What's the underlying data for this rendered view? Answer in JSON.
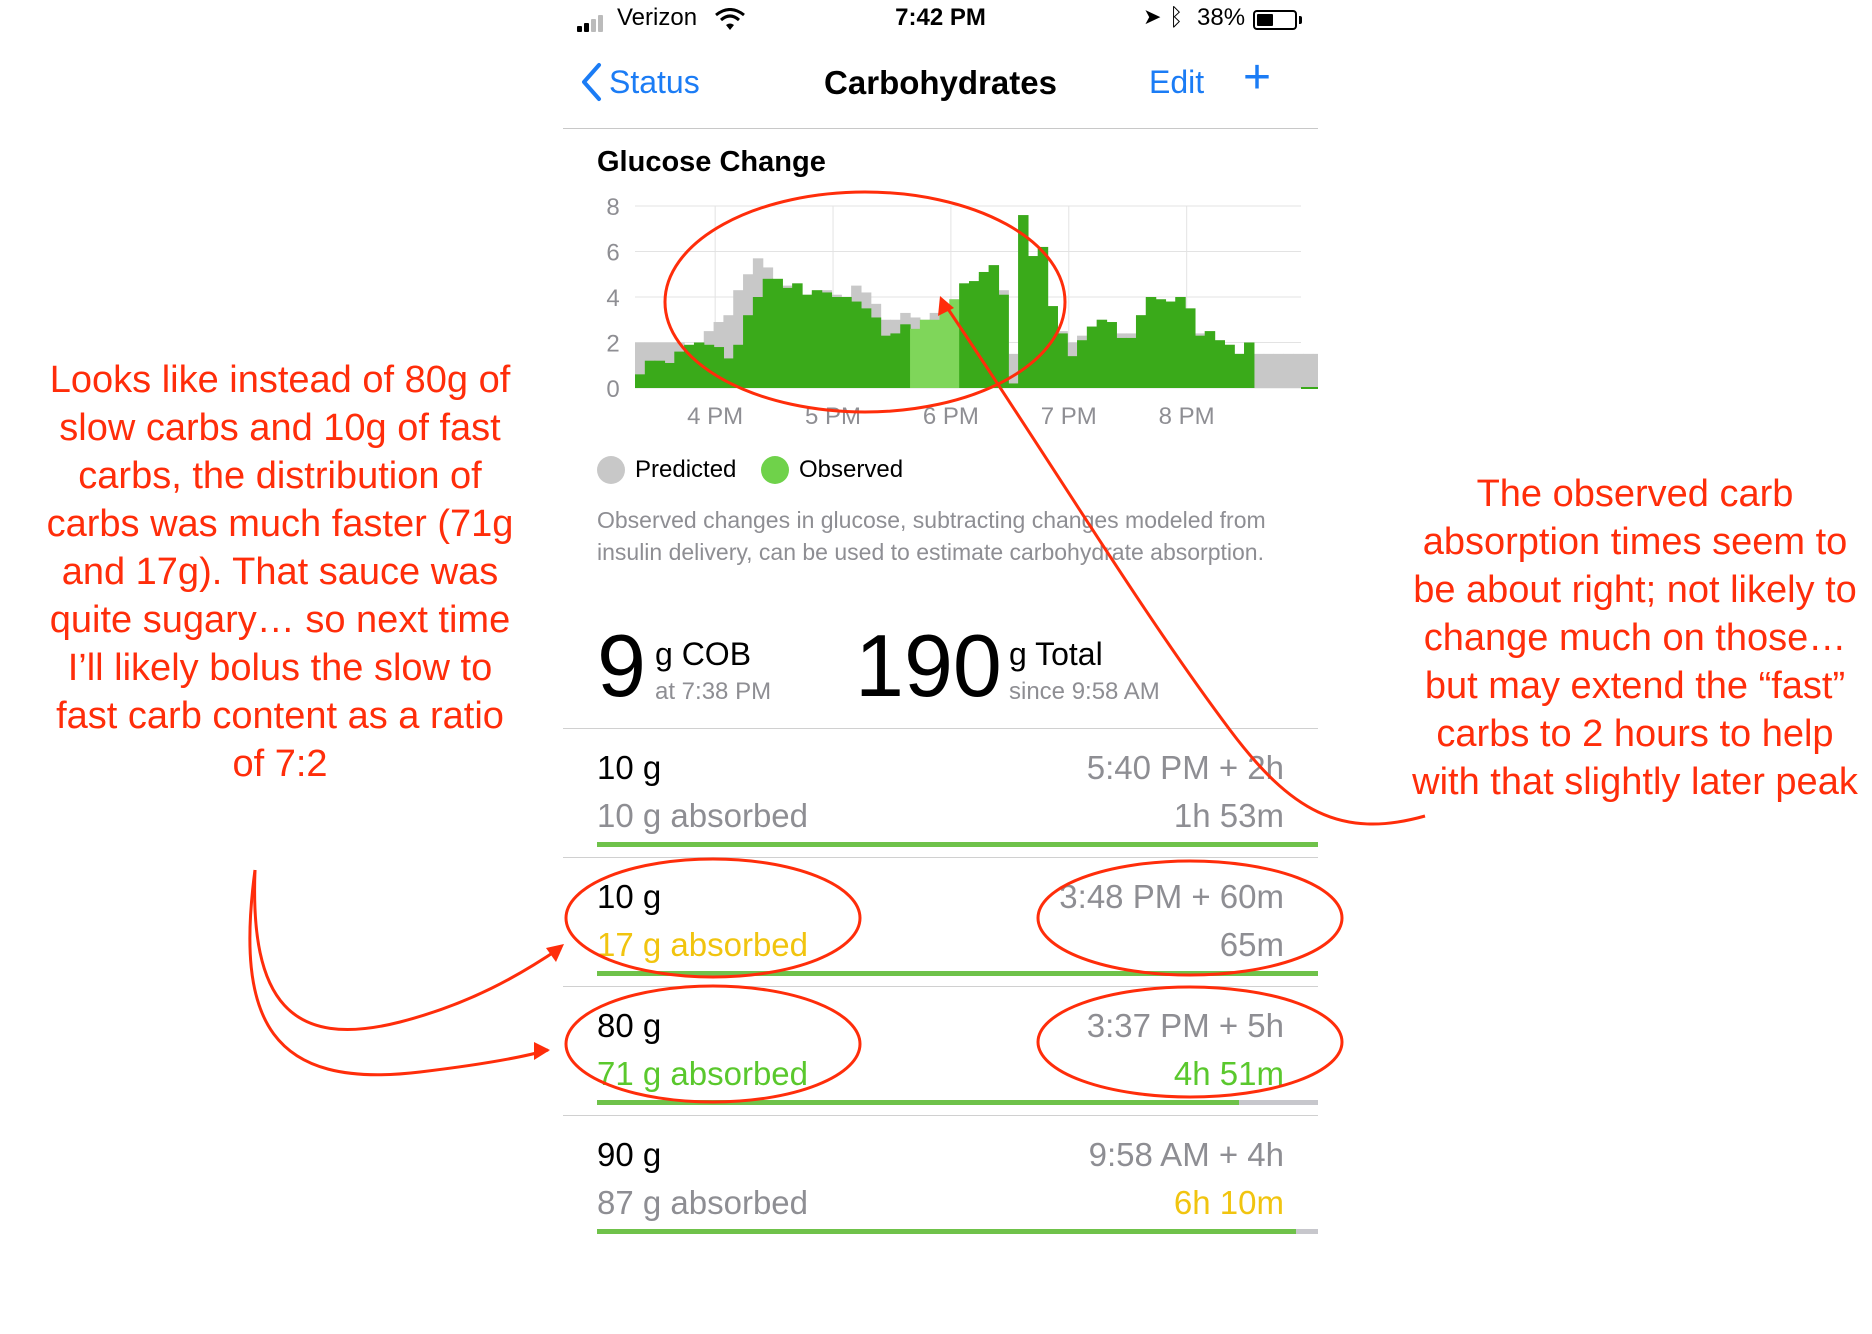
{
  "status_bar": {
    "carrier": "Verizon",
    "time": "7:42 PM",
    "battery": "38%"
  },
  "nav": {
    "back_label": "Status",
    "title": "Carbohydrates",
    "edit_label": "Edit",
    "add_label": "+"
  },
  "chart": {
    "title": "Glucose Change",
    "legend_predicted": "Predicted",
    "legend_observed": "Observed"
  },
  "chart_data": {
    "type": "bar",
    "title": "Glucose Change",
    "y_ticks": [
      "8",
      "6",
      "4",
      "2",
      "0"
    ],
    "x_ticks": [
      "4 PM",
      "5 PM",
      "6 PM",
      "7 PM",
      "8 PM"
    ],
    "ylim": [
      0,
      8
    ],
    "xlim": [
      15.32,
      20.97
    ],
    "grid": true,
    "legend": "bottom-left",
    "colors": {
      "predicted": "#c8c8c8",
      "observed": "#3aaa1a",
      "observed_light": "#7fd65a"
    },
    "observed": [
      0.6,
      1.2,
      1.2,
      1.1,
      1.6,
      1.9,
      2.0,
      1.9,
      1.8,
      1.3,
      1.9,
      3.2,
      4.0,
      4.8,
      4.8,
      4.4,
      4.6,
      4.1,
      4.3,
      4.2,
      4.0,
      4.0,
      3.8,
      3.5,
      3.1,
      2.3,
      2.4,
      2.8,
      2.6,
      3.0,
      3.0,
      3.5,
      3.9,
      4.6,
      4.7,
      5.1,
      5.4,
      4.1,
      0.2,
      7.6,
      5.8,
      6.2,
      3.6,
      2.4,
      1.4,
      2.1,
      2.7,
      3.0,
      2.9,
      2.2,
      2.2,
      3.2,
      4.0,
      3.9,
      3.8,
      4.0,
      3.5,
      2.3,
      2.5,
      2.1,
      1.9,
      1.5,
      2.0
    ],
    "predicted": [
      2.0,
      2.0,
      2.0,
      2.0,
      2.0,
      1.8,
      1.9,
      2.5,
      2.9,
      3.2,
      4.3,
      5.0,
      5.7,
      5.3,
      4.4,
      4.5,
      4.6,
      4.1,
      4.2,
      4.3,
      4.1,
      4.0,
      4.5,
      4.2,
      3.7,
      3.0,
      3.0,
      3.3,
      3.1,
      3.0,
      3.3,
      3.6,
      3.9,
      4.6,
      4.6,
      4.9,
      5.4,
      4.3,
      1.5,
      7.6,
      5.8,
      6.2,
      3.6,
      2.5,
      2.0,
      2.3,
      2.7,
      3.0,
      2.9,
      2.4,
      2.4,
      3.2,
      4.0,
      3.9,
      3.8,
      4.0,
      3.5,
      2.4,
      2.5,
      2.1,
      1.9,
      1.5,
      2.0,
      1.5,
      1.5,
      1.5,
      1.5,
      1.5,
      1.5,
      1.5,
      1.5,
      1.5,
      1.2,
      1.2
    ]
  },
  "description": "Observed changes in glucose, subtracting changes modeled from insulin delivery, can be used to estimate carbohydrate absorption.",
  "cob": {
    "value": "9",
    "unit": "g COB",
    "sub": "at 7:38 PM"
  },
  "total": {
    "value": "190",
    "unit": "g Total",
    "sub": "since 9:58 AM"
  },
  "entries": [
    {
      "amount": "10 g",
      "absorbed": "10 g absorbed",
      "absorbed_color": "#8e8e93",
      "start": "5:40 PM + 2h",
      "duration": "1h 53m",
      "duration_color": "#8e8e93",
      "progress": 1.0
    },
    {
      "amount": "10 g",
      "absorbed": "17 g absorbed",
      "absorbed_color": "#f1c40f",
      "start": "3:48 PM + 60m",
      "duration": "65m",
      "duration_color": "#8e8e93",
      "progress": 1.0
    },
    {
      "amount": "80 g",
      "absorbed": "71 g absorbed",
      "absorbed_color": "#5ac82d",
      "start": "3:37 PM + 5h",
      "duration": "4h 51m",
      "duration_color": "#5ac82d",
      "progress": 0.89
    },
    {
      "amount": "90 g",
      "absorbed": "87 g absorbed",
      "absorbed_color": "#8e8e93",
      "start": "9:58 AM + 4h",
      "duration": "6h 10m",
      "duration_color": "#f1c40f",
      "progress": 0.97
    }
  ],
  "annotations": {
    "left": "Looks like instead of 80g of slow carbs and 10g of fast carbs, the distribution of carbs was much faster (71g and 17g).  That sauce was quite sugary… so next time I’ll likely bolus the slow to fast carb content as a ratio of 7:2",
    "right": "The observed carb absorption times seem to be about right; not likely to change much on those…but may extend the “fast” carbs to 2 hours to help with that slightly later peak",
    "color": "#ff2d0a"
  }
}
